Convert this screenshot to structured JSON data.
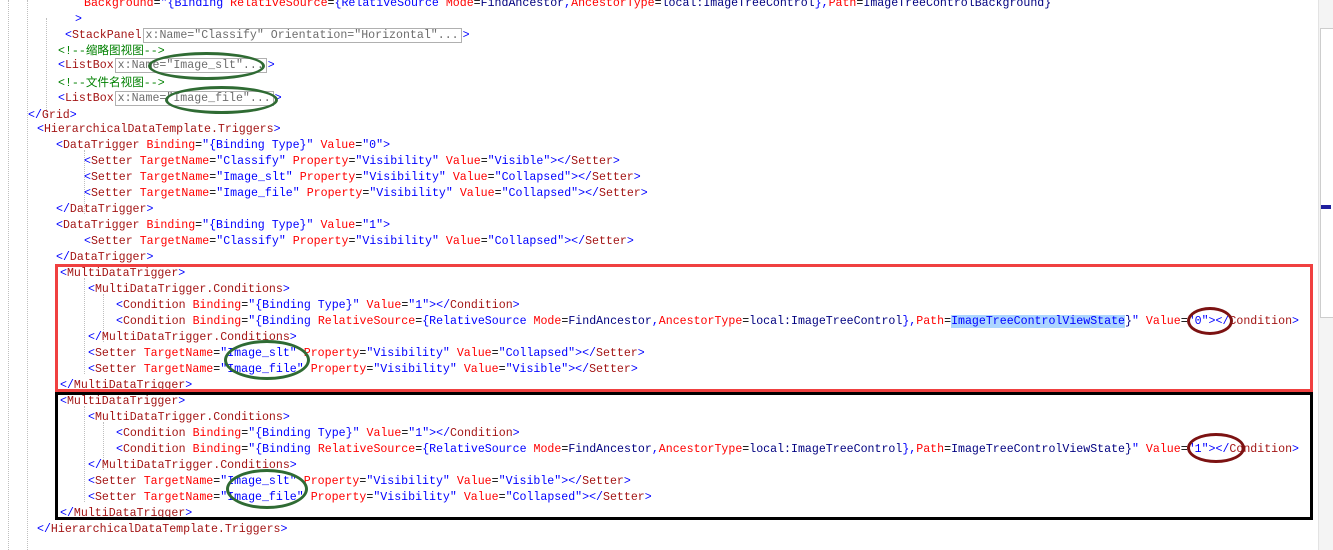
{
  "editor": {
    "language": "XAML",
    "font_size_px": 11.6,
    "line_height_px": 16,
    "colors": {
      "tag": "#a31515",
      "attribute": "#ff0000",
      "value": "#0000ff",
      "comment": "#008000",
      "bracket": "#0000ff",
      "selection_highlight": "#add6ff",
      "annotation_green": "#2f6b33",
      "annotation_dark_red": "#7c1212",
      "annotation_red_box": "#f04040",
      "annotation_black_box": "#000000",
      "background": "#ffffff"
    }
  },
  "lines": [
    {
      "indent": 0,
      "text": "Background=\"{Binding RelativeSource={RelativeSource Mode=FindAncestor,AncestorType=local:ImageTreeControl},Path=ImageTreeControlBackground}"
    },
    {
      "indent": 0,
      "text": ">"
    },
    {
      "indent": 0,
      "text": "<StackPanel x:Name=\"Classify\" Orientation=\"Horizontal\"...>"
    },
    {
      "indent": 0,
      "text": "<!--缩略图视图-->"
    },
    {
      "indent": 0,
      "text": "<ListBox x:Name=\"Image_slt\"...>"
    },
    {
      "indent": 0,
      "text": "<!--文件名视图-->"
    },
    {
      "indent": 0,
      "text": "<ListBox x:Name=\"Image_file\"...>"
    },
    {
      "indent": 0,
      "text": "</Grid>"
    },
    {
      "indent": 0,
      "text": "<HierarchicalDataTemplate.Triggers>"
    },
    {
      "indent": 0,
      "text": "<DataTrigger Binding=\"{Binding Type}\" Value=\"0\">"
    },
    {
      "indent": 0,
      "text": "<Setter TargetName=\"Classify\" Property=\"Visibility\" Value=\"Visible\"></Setter>"
    },
    {
      "indent": 0,
      "text": "<Setter TargetName=\"Image_slt\" Property=\"Visibility\" Value=\"Collapsed\"></Setter>"
    },
    {
      "indent": 0,
      "text": "<Setter TargetName=\"Image_file\" Property=\"Visibility\" Value=\"Collapsed\"></Setter>"
    },
    {
      "indent": 0,
      "text": "</DataTrigger>"
    },
    {
      "indent": 0,
      "text": "<DataTrigger Binding=\"{Binding Type}\" Value=\"1\">"
    },
    {
      "indent": 0,
      "text": "<Setter TargetName=\"Classify\" Property=\"Visibility\" Value=\"Collapsed\"></Setter>"
    },
    {
      "indent": 0,
      "text": "</DataTrigger>"
    },
    {
      "indent": 0,
      "text": "<MultiDataTrigger>"
    },
    {
      "indent": 0,
      "text": "<MultiDataTrigger.Conditions>"
    },
    {
      "indent": 0,
      "text": "<Condition Binding=\"{Binding Type}\" Value=\"1\"></Condition>"
    },
    {
      "indent": 0,
      "text": "<Condition Binding=\"{Binding RelativeSource={RelativeSource Mode=FindAncestor,AncestorType=local:ImageTreeControl},Path=ImageTreeControlViewState}\" Value=\"0\"></Condition>"
    },
    {
      "indent": 0,
      "text": "</MultiDataTrigger.Conditions>"
    },
    {
      "indent": 0,
      "text": "<Setter TargetName=\"Image_slt\" Property=\"Visibility\" Value=\"Collapsed\"></Setter>"
    },
    {
      "indent": 0,
      "text": "<Setter TargetName=\"Image_file\" Property=\"Visibility\" Value=\"Visible\"></Setter>"
    },
    {
      "indent": 0,
      "text": "</MultiDataTrigger>"
    },
    {
      "indent": 0,
      "text": "<MultiDataTrigger>"
    },
    {
      "indent": 0,
      "text": "<MultiDataTrigger.Conditions>"
    },
    {
      "indent": 0,
      "text": "<Condition Binding=\"{Binding Type}\" Value=\"1\"></Condition>"
    },
    {
      "indent": 0,
      "text": "<Condition Binding=\"{Binding RelativeSource={RelativeSource Mode=FindAncestor,AncestorType=local:ImageTreeControl},Path=ImageTreeControlViewState}\" Value=\"1\"></Condition>"
    },
    {
      "indent": 0,
      "text": "</MultiDataTrigger.Conditions>"
    },
    {
      "indent": 0,
      "text": "<Setter TargetName=\"Image_slt\" Property=\"Visibility\" Value=\"Visible\"></Setter>"
    },
    {
      "indent": 0,
      "text": "<Setter TargetName=\"Image_file\" Property=\"Visibility\" Value=\"Collapsed\"></Setter>"
    },
    {
      "indent": 0,
      "text": "</MultiDataTrigger>"
    },
    {
      "indent": 0,
      "text": "</HierarchicalDataTemplate.Triggers>"
    }
  ],
  "collapsed_regions": [
    {
      "line": 3,
      "text": "x:Name=\"Classify\" Orientation=\"Horizontal\"..."
    },
    {
      "line": 5,
      "text": "x:Name=\"Image_slt\"..."
    },
    {
      "line": 7,
      "text": "x:Name=\"Image_file\"..."
    }
  ],
  "selection": {
    "text": "ImageTreeControlViewState",
    "line": 21,
    "note": "highlighted blue on the first MultiDataTrigger Condition Path"
  },
  "annotations": {
    "rectangles": [
      {
        "name": "first-multidatatrigger-highlight",
        "color": "#f04040",
        "label": "red box around first MultiDataTrigger"
      },
      {
        "name": "second-multidatatrigger-highlight",
        "color": "#000000",
        "label": "black box around second MultiDataTrigger"
      }
    ],
    "ellipses": [
      {
        "name": "image-slt-collapsed-ellipse",
        "color": "#2f6b33",
        "targets": "Image_slt"
      },
      {
        "name": "image-file-collapsed-ellipse",
        "color": "#2f6b33",
        "targets": "Image_file"
      },
      {
        "name": "setters-red-block-ellipse",
        "color": "#2f6b33",
        "targets": "Image_slt / Image_file"
      },
      {
        "name": "setters-black-block-ellipse",
        "color": "#2f6b33",
        "targets": "Image_slt / Image_file"
      },
      {
        "name": "viewstate-value-zero-ellipse",
        "color": "#7c1212",
        "targets": "=\"0\""
      },
      {
        "name": "viewstate-value-one-ellipse",
        "color": "#7c1212",
        "targets": "=\"1\""
      }
    ]
  },
  "scrollbar": {
    "marker_color": "#1f1f9e",
    "orientation": "vertical"
  }
}
